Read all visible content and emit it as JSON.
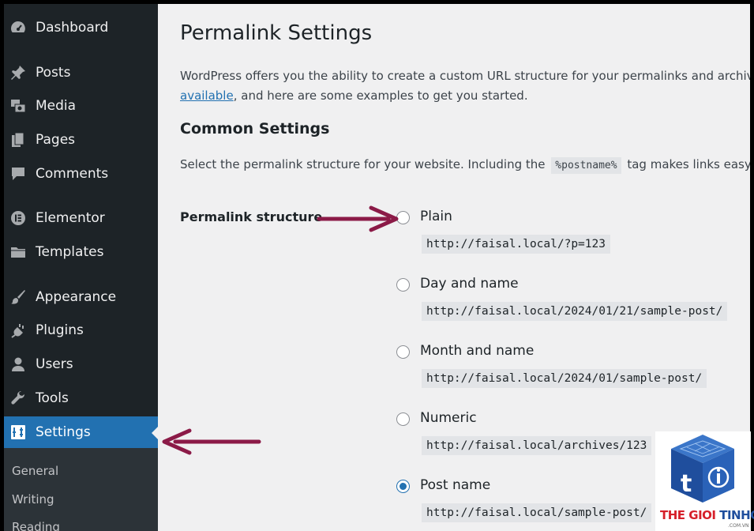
{
  "sidebar": {
    "items": [
      {
        "label": "Dashboard",
        "icon": "dashboard-icon"
      },
      {
        "label": "Posts",
        "icon": "pin-icon"
      },
      {
        "label": "Media",
        "icon": "media-icon"
      },
      {
        "label": "Pages",
        "icon": "pages-icon"
      },
      {
        "label": "Comments",
        "icon": "comment-icon"
      },
      {
        "label": "Elementor",
        "icon": "elementor-icon"
      },
      {
        "label": "Templates",
        "icon": "folder-icon"
      },
      {
        "label": "Appearance",
        "icon": "brush-icon"
      },
      {
        "label": "Plugins",
        "icon": "plug-icon"
      },
      {
        "label": "Users",
        "icon": "user-icon"
      },
      {
        "label": "Tools",
        "icon": "wrench-icon"
      },
      {
        "label": "Settings",
        "icon": "settings-icon",
        "active": true
      }
    ],
    "submenu": [
      "General",
      "Writing",
      "Reading"
    ]
  },
  "page": {
    "title": "Permalink Settings",
    "intro_line1": "WordPress offers you the ability to create a custom URL structure for your permalinks and archives. C",
    "intro_link": "available",
    "intro_line2_rest": ", and here are some examples to get you started.",
    "section_title": "Common Settings",
    "desc_before": "Select the permalink structure for your website. Including the",
    "desc_code": "%postname%",
    "desc_after": "tag makes links easy to u",
    "structure_label": "Permalink structure"
  },
  "options": [
    {
      "label": "Plain",
      "example": "http://faisal.local/?p=123",
      "checked": false
    },
    {
      "label": "Day and name",
      "example": "http://faisal.local/2024/01/21/sample-post/",
      "checked": false
    },
    {
      "label": "Month and name",
      "example": "http://faisal.local/2024/01/sample-post/",
      "checked": false
    },
    {
      "label": "Numeric",
      "example": "http://faisal.local/archives/123",
      "checked": false
    },
    {
      "label": "Post name",
      "example": "http://faisal.local/sample-post/",
      "checked": true
    }
  ],
  "watermark": {
    "text_red": "THE GIOI",
    "text_blue": "TINHOC",
    "sub": ".COM.VN"
  },
  "colors": {
    "sidebar": "#1d2327",
    "accent": "#2271b1",
    "arrow": "#8b1a47"
  }
}
